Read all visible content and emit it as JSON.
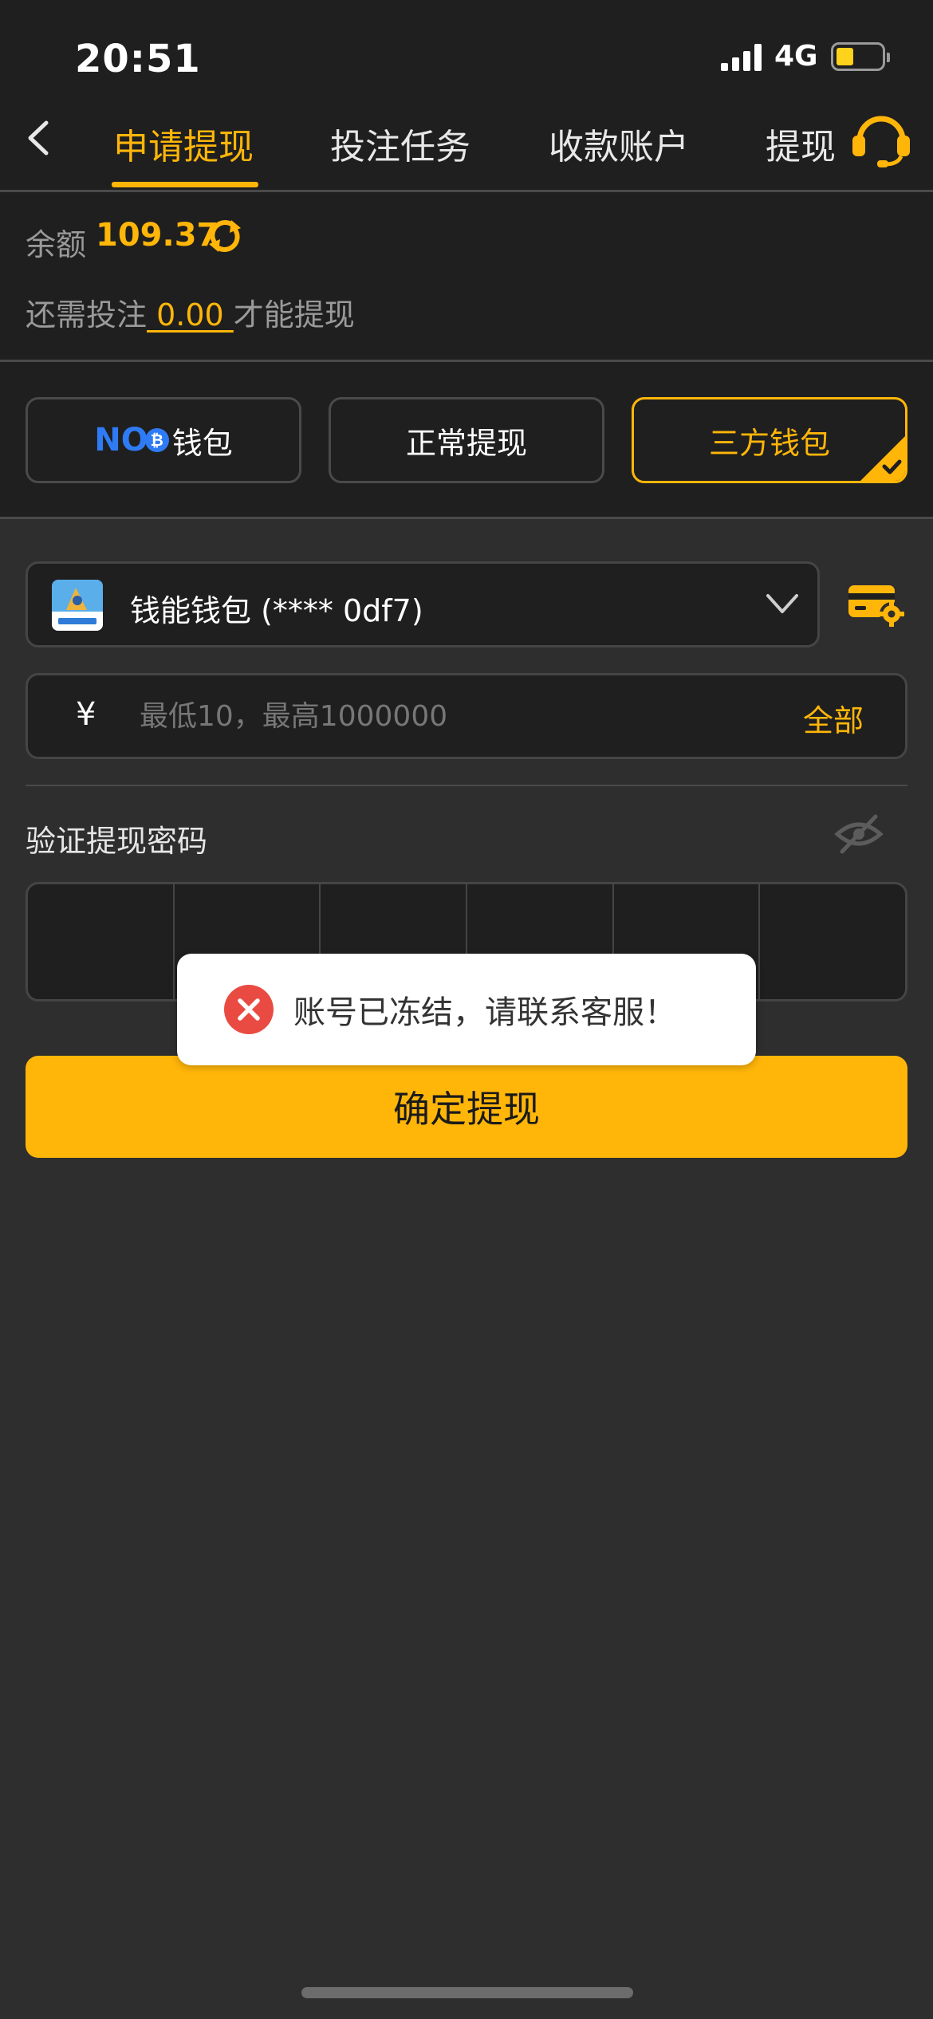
{
  "status_bar": {
    "time": "20:51",
    "network": "4G"
  },
  "nav": {
    "tabs": [
      {
        "label": "申请提现",
        "active": true
      },
      {
        "label": "投注任务",
        "active": false
      },
      {
        "label": "收款账户",
        "active": false
      },
      {
        "label": "提现",
        "active": false
      }
    ],
    "accent_color": "#ffb609"
  },
  "balance": {
    "label": "余额",
    "value": "109.37",
    "need_prefix": "还需投注",
    "need_amount": " 0.00 ",
    "need_suffix": "才能提现"
  },
  "methods": [
    {
      "logo_text": "NO",
      "label": "钱包",
      "selected": false
    },
    {
      "label": "正常提现",
      "selected": false
    },
    {
      "label": "三方钱包",
      "selected": true
    }
  ],
  "wallet": {
    "name": "钱能钱包 (**** 0df7)"
  },
  "amount": {
    "currency": "¥",
    "placeholder": "最低10，最高1000000",
    "all_label": "全部"
  },
  "password": {
    "label": "验证提现密码",
    "digits": 6
  },
  "submit": {
    "label": "确定提现"
  },
  "toast": {
    "message": "账号已冻结，请联系客服！"
  }
}
